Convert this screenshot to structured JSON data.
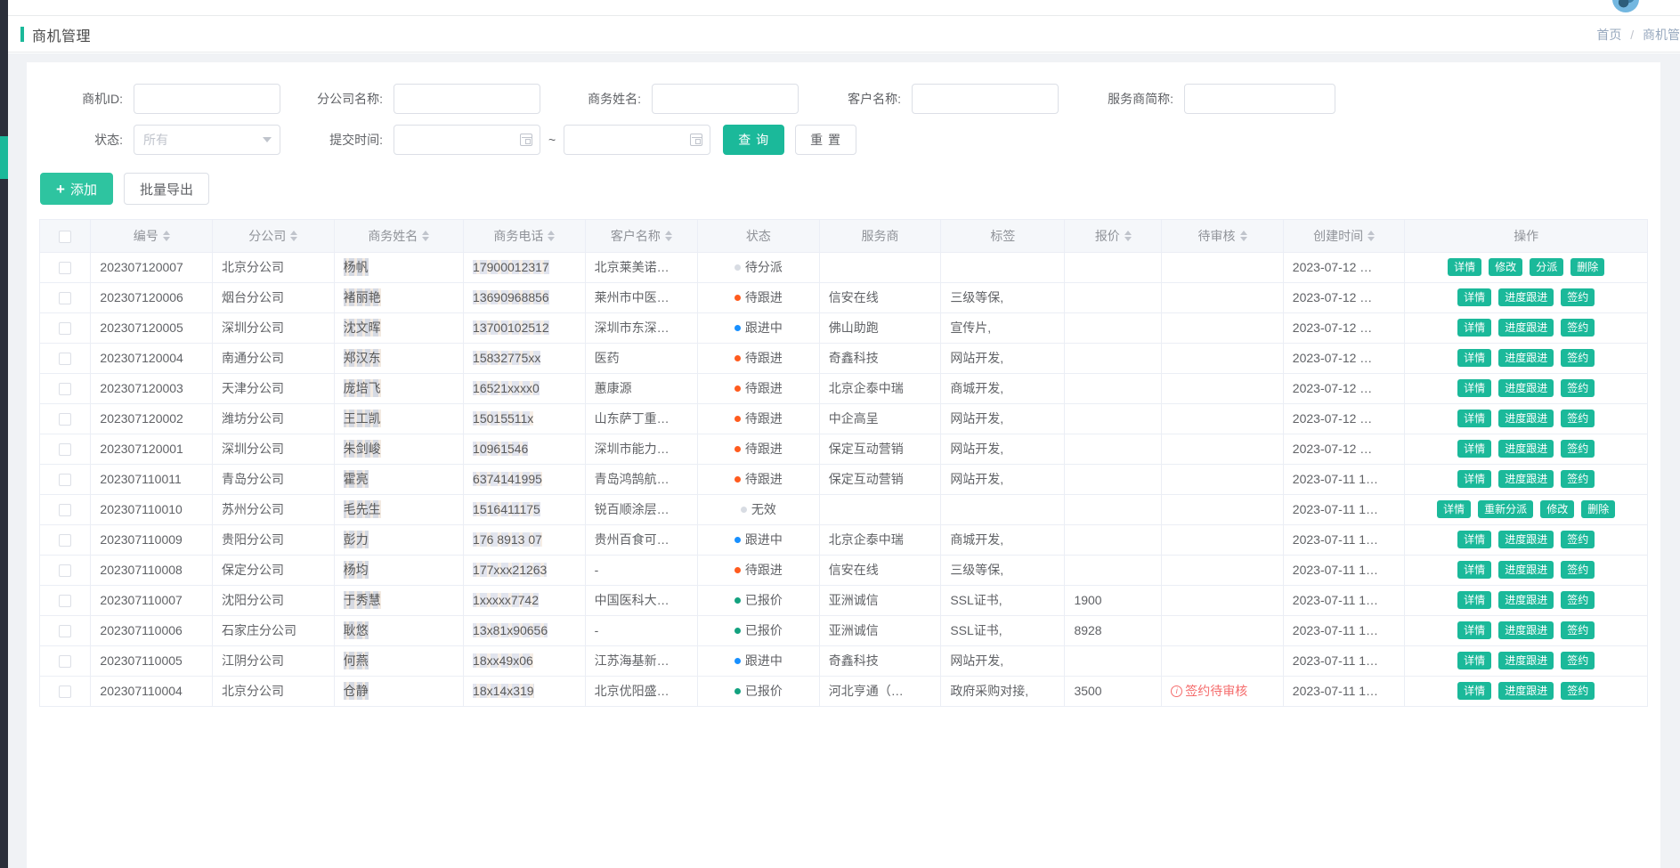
{
  "header": {
    "page_title": "商机管理",
    "breadcrumb": {
      "home": "首页",
      "separator": "/",
      "current": "商机管"
    }
  },
  "search_form": {
    "fields": [
      {
        "label": "商机ID:",
        "value": "",
        "placeholder": ""
      },
      {
        "label": "分公司名称:",
        "value": "",
        "placeholder": ""
      },
      {
        "label": "商务姓名:",
        "value": "",
        "placeholder": ""
      },
      {
        "label": "客户名称:",
        "value": "",
        "placeholder": ""
      },
      {
        "label": "服务商简称:",
        "value": "",
        "placeholder": ""
      }
    ],
    "status": {
      "label": "状态:",
      "value": "所有",
      "options": [
        "所有",
        "待分派",
        "待跟进",
        "跟进中",
        "已报价",
        "无效"
      ]
    },
    "submit_time": {
      "label": "提交时间:",
      "start": "",
      "end": "",
      "range_sep": "~",
      "placeholder": ""
    },
    "search_button": "查 询",
    "reset_button": "重 置"
  },
  "toolbar": {
    "add_button": "添加",
    "add_icon": "plus-icon",
    "export_button": "批量导出"
  },
  "table": {
    "columns": [
      {
        "label": "",
        "sortable": false,
        "key": "checkbox"
      },
      {
        "label": "编号",
        "sortable": true
      },
      {
        "label": "分公司",
        "sortable": true
      },
      {
        "label": "商务姓名",
        "sortable": true
      },
      {
        "label": "商务电话",
        "sortable": true
      },
      {
        "label": "客户名称",
        "sortable": true
      },
      {
        "label": "状态",
        "sortable": false
      },
      {
        "label": "服务商",
        "sortable": false
      },
      {
        "label": "标签",
        "sortable": false
      },
      {
        "label": "报价",
        "sortable": true
      },
      {
        "label": "待审核",
        "sortable": true
      },
      {
        "label": "创建时间",
        "sortable": true
      },
      {
        "label": "操作",
        "sortable": false
      }
    ],
    "status_colors": {
      "待分派": "#d8dce3",
      "待跟进": "#ff5b1e",
      "跟进中": "#1890ff",
      "已报价": "#13a27f",
      "无效": "#d8dce3"
    },
    "rows": [
      {
        "id": "202307120007",
        "branch": "北京分公司",
        "agent": "杨帆",
        "phone": "17900012317",
        "customer": "北京莱美诺…",
        "status": "待分派",
        "provider": "",
        "tag": "",
        "price": "",
        "review": "",
        "created": "2023-07-12 …",
        "actions": [
          "详情",
          "修改",
          "分派",
          "删除"
        ]
      },
      {
        "id": "202307120006",
        "branch": "烟台分公司",
        "agent": "褚丽艳",
        "phone": "13690968856",
        "customer": "莱州市中医…",
        "status": "待跟进",
        "provider": "信安在线",
        "tag": "三级等保,",
        "price": "",
        "review": "",
        "created": "2023-07-12 …",
        "actions": [
          "详情",
          "进度跟进",
          "签约"
        ]
      },
      {
        "id": "202307120005",
        "branch": "深圳分公司",
        "agent": "沈文晖",
        "phone": "13700102512",
        "customer": "深圳市东深…",
        "status": "跟进中",
        "provider": "佛山助跑",
        "tag": "宣传片,",
        "price": "",
        "review": "",
        "created": "2023-07-12 …",
        "actions": [
          "详情",
          "进度跟进",
          "签约"
        ]
      },
      {
        "id": "202307120004",
        "branch": "南通分公司",
        "agent": "郑汉东",
        "phone": "15832775xx",
        "customer": "医药",
        "status": "待跟进",
        "provider": "奇鑫科技",
        "tag": "网站开发,",
        "price": "",
        "review": "",
        "created": "2023-07-12 …",
        "actions": [
          "详情",
          "进度跟进",
          "签约"
        ]
      },
      {
        "id": "202307120003",
        "branch": "天津分公司",
        "agent": "庞培飞",
        "phone": "16521xxxx0",
        "customer": "蕙康源",
        "status": "待跟进",
        "provider": "北京企泰中瑞",
        "tag": "商城开发,",
        "price": "",
        "review": "",
        "created": "2023-07-12 …",
        "actions": [
          "详情",
          "进度跟进",
          "签约"
        ]
      },
      {
        "id": "202307120002",
        "branch": "潍坊分公司",
        "agent": "王工凯",
        "phone": "15015511x",
        "customer": "山东萨丁重…",
        "status": "待跟进",
        "provider": "中企高呈",
        "tag": "网站开发,",
        "price": "",
        "review": "",
        "created": "2023-07-12 …",
        "actions": [
          "详情",
          "进度跟进",
          "签约"
        ]
      },
      {
        "id": "202307120001",
        "branch": "深圳分公司",
        "agent": "朱剑峻",
        "phone": "10961546",
        "customer": "深圳市能力…",
        "status": "待跟进",
        "provider": "保定互动营销",
        "tag": "网站开发,",
        "price": "",
        "review": "",
        "created": "2023-07-12 …",
        "actions": [
          "详情",
          "进度跟进",
          "签约"
        ]
      },
      {
        "id": "202307110011",
        "branch": "青岛分公司",
        "agent": "霍亮",
        "phone": "6374141995",
        "customer": "青岛鸿鹄航…",
        "status": "待跟进",
        "provider": "保定互动营销",
        "tag": "网站开发,",
        "price": "",
        "review": "",
        "created": "2023-07-11 1…",
        "actions": [
          "详情",
          "进度跟进",
          "签约"
        ]
      },
      {
        "id": "202307110010",
        "branch": "苏州分公司",
        "agent": "毛先生",
        "phone": "1516411175",
        "customer": "锐百顺涂层…",
        "status": "无效",
        "provider": "",
        "tag": "",
        "price": "",
        "review": "",
        "created": "2023-07-11 1…",
        "actions": [
          "详情",
          "重新分派",
          "修改",
          "删除"
        ]
      },
      {
        "id": "202307110009",
        "branch": "贵阳分公司",
        "agent": "彭力",
        "phone": "176 8913 07",
        "customer": "贵州百食可…",
        "status": "跟进中",
        "provider": "北京企泰中瑞",
        "tag": "商城开发,",
        "price": "",
        "review": "",
        "created": "2023-07-11 1…",
        "actions": [
          "详情",
          "进度跟进",
          "签约"
        ]
      },
      {
        "id": "202307110008",
        "branch": "保定分公司",
        "agent": "杨均",
        "phone": "177xxx21263",
        "customer": "-",
        "status": "待跟进",
        "provider": "信安在线",
        "tag": "三级等保,",
        "price": "",
        "review": "",
        "created": "2023-07-11 1…",
        "actions": [
          "详情",
          "进度跟进",
          "签约"
        ]
      },
      {
        "id": "202307110007",
        "branch": "沈阳分公司",
        "agent": "于秀慧",
        "phone": "1xxxxx7742",
        "customer": "中国医科大…",
        "status": "已报价",
        "provider": "亚洲诚信",
        "tag": "SSL证书,",
        "price": "1900",
        "review": "",
        "created": "2023-07-11 1…",
        "actions": [
          "详情",
          "进度跟进",
          "签约"
        ]
      },
      {
        "id": "202307110006",
        "branch": "石家庄分公司",
        "agent": "耿悠",
        "phone": "13x81x90656",
        "customer": "-",
        "status": "已报价",
        "provider": "亚洲诚信",
        "tag": "SSL证书,",
        "price": "8928",
        "review": "",
        "created": "2023-07-11 1…",
        "actions": [
          "详情",
          "进度跟进",
          "签约"
        ]
      },
      {
        "id": "202307110005",
        "branch": "江阴分公司",
        "agent": "何燕",
        "phone": "18xx49x06",
        "customer": "江苏海基新…",
        "status": "跟进中",
        "provider": "奇鑫科技",
        "tag": "网站开发,",
        "price": "",
        "review": "",
        "created": "2023-07-11 1…",
        "actions": [
          "详情",
          "进度跟进",
          "签约"
        ]
      },
      {
        "id": "202307110004",
        "branch": "北京分公司",
        "agent": "仓静",
        "phone": "18x14x319",
        "customer": "北京优阳盛…",
        "status": "已报价",
        "provider": "河北亨通（…",
        "tag": "政府采购对接,",
        "price": "3500",
        "review": "签约待审核",
        "review_icon": "info-circle-icon",
        "created": "2023-07-11 1…",
        "actions": [
          "详情",
          "进度跟进",
          "签约"
        ]
      }
    ]
  },
  "theme": {
    "primary": "#1bb99a",
    "add_button": "#2ec4a0",
    "danger": "#f56c6c",
    "header_bg": "#f5f7fa"
  }
}
